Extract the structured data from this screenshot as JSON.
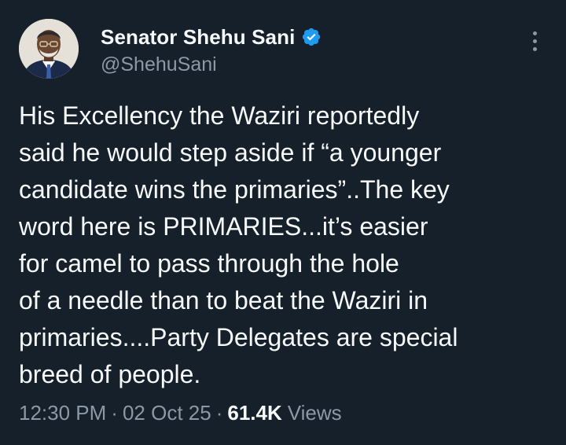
{
  "author": {
    "display_name": "Senator Shehu Sani",
    "handle": "@ShehuSani",
    "verified": true,
    "avatar_icon": "avatar-photo"
  },
  "tweet": {
    "lines": [
      "His Excellency the Waziri reportedly",
      "said he would step aside if “a younger",
      "candidate wins the primaries”..The key",
      "word here is PRIMARIES...it’s easier",
      "for camel to pass through the hole",
      "of a needle than to beat the Waziri in",
      "primaries....Party Delegates are special",
      "breed of people."
    ]
  },
  "meta": {
    "time": "12:30 PM",
    "separator": "·",
    "date": "02 Oct 25",
    "views_count": "61.4K",
    "views_label": "Views"
  },
  "icons": {
    "verified": "verified-badge-icon",
    "more": "more-options-icon"
  },
  "colors": {
    "background": "#15202b",
    "primary_text": "#f7f9f9",
    "secondary_text": "#8b98a5",
    "verified_blue": "#1d9bf0"
  }
}
